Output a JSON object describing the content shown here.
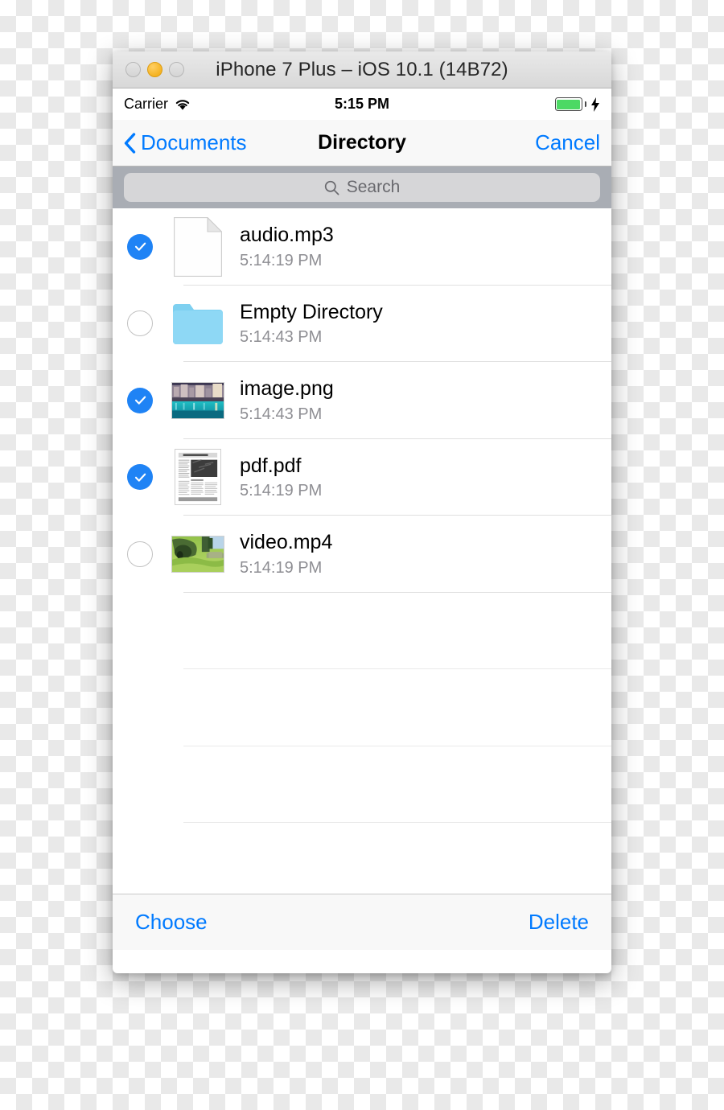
{
  "window": {
    "title": "iPhone 7 Plus – iOS 10.1 (14B72)",
    "traffic_lights": [
      "close",
      "minimize",
      "zoom"
    ]
  },
  "status_bar": {
    "carrier": "Carrier",
    "wifi_icon": "wifi-icon",
    "time": "5:15 PM",
    "battery_icon": "battery-icon",
    "charging_icon": "lightning-bolt-icon",
    "battery_color": "#4cd964"
  },
  "nav_bar": {
    "back_icon": "chevron-left-icon",
    "back_label": "Documents",
    "title": "Directory",
    "cancel_label": "Cancel",
    "tint_color": "#007aff"
  },
  "search": {
    "icon": "search-icon",
    "placeholder": "Search",
    "value": ""
  },
  "file_list": {
    "rows": [
      {
        "name": "audio.mp3",
        "date": "5:14:19 PM",
        "selected": true,
        "icon": "document-icon"
      },
      {
        "name": "Empty Directory",
        "date": "5:14:43 PM",
        "selected": false,
        "icon": "folder-icon"
      },
      {
        "name": "image.png",
        "date": "5:14:43 PM",
        "selected": true,
        "icon": "image-thumbnail"
      },
      {
        "name": "pdf.pdf",
        "date": "5:14:19 PM",
        "selected": true,
        "icon": "pdf-thumbnail"
      },
      {
        "name": "video.mp4",
        "date": "5:14:19 PM",
        "selected": false,
        "icon": "video-thumbnail"
      }
    ],
    "empty_row_count": 4
  },
  "toolbar": {
    "choose_label": "Choose",
    "delete_label": "Delete"
  }
}
